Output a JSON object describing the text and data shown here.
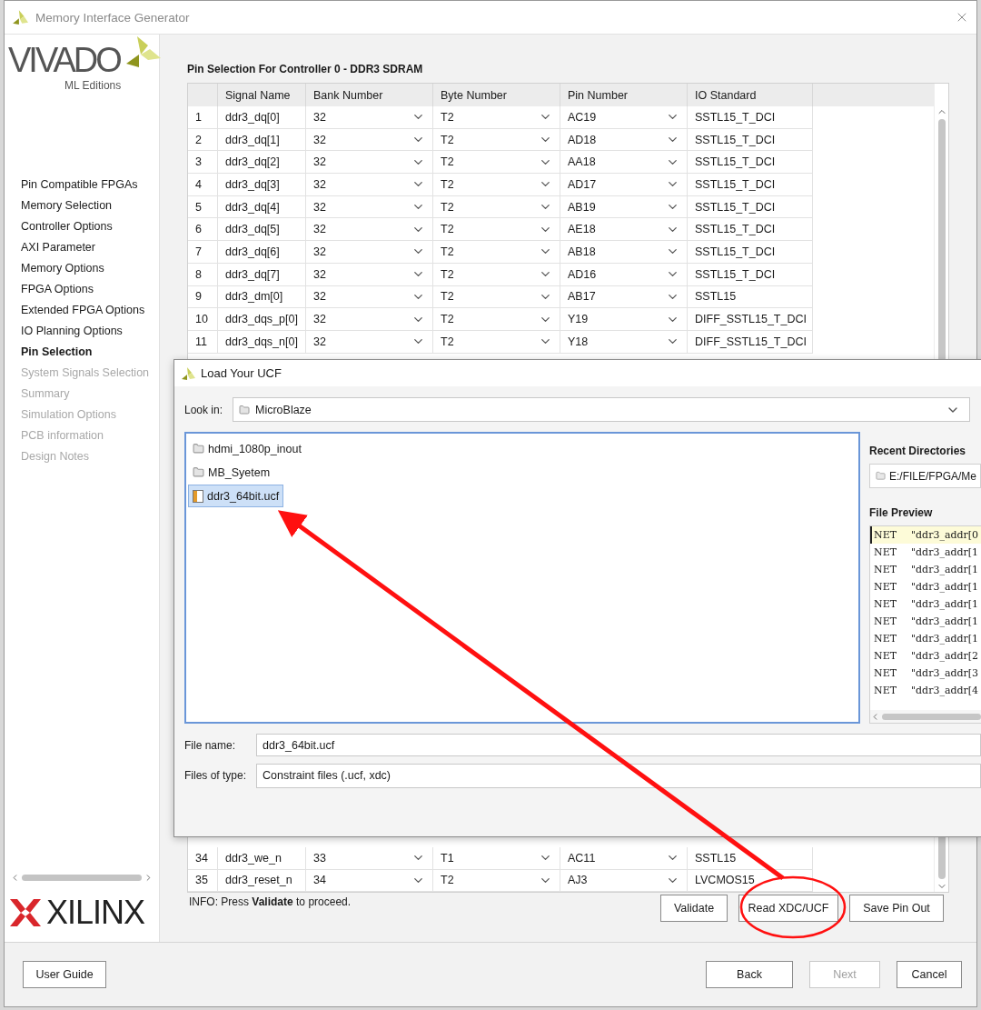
{
  "window": {
    "title": "Memory Interface Generator"
  },
  "logo": {
    "product": "VIVADO",
    "edition": "ML Editions",
    "vendor": "XILINX"
  },
  "sidebar": {
    "items": [
      {
        "label": "Pin Compatible FPGAs",
        "selected": false,
        "disabled": false
      },
      {
        "label": "Memory Selection",
        "selected": false,
        "disabled": false
      },
      {
        "label": "Controller Options",
        "selected": false,
        "disabled": false
      },
      {
        "label": "AXI Parameter",
        "selected": false,
        "disabled": false
      },
      {
        "label": "Memory Options",
        "selected": false,
        "disabled": false
      },
      {
        "label": "FPGA Options",
        "selected": false,
        "disabled": false
      },
      {
        "label": "Extended FPGA Options",
        "selected": false,
        "disabled": false
      },
      {
        "label": "IO Planning Options",
        "selected": false,
        "disabled": false
      },
      {
        "label": "Pin Selection",
        "selected": true,
        "disabled": false
      },
      {
        "label": "System Signals Selection",
        "selected": false,
        "disabled": true
      },
      {
        "label": "Summary",
        "selected": false,
        "disabled": true
      },
      {
        "label": "Simulation Options",
        "selected": false,
        "disabled": true
      },
      {
        "label": "PCB information",
        "selected": false,
        "disabled": true
      },
      {
        "label": "Design Notes",
        "selected": false,
        "disabled": true
      }
    ]
  },
  "page": {
    "heading": "Pin Selection For Controller 0 - DDR3 SDRAM",
    "table": {
      "columns": [
        "Signal Name",
        "Bank Number",
        "Byte Number",
        "Pin Number",
        "IO Standard"
      ],
      "rows": [
        {
          "index": "1",
          "signal": "ddr3_dq[0]",
          "bank": "32",
          "byte": "T2",
          "pin": "AC19",
          "io_standard": "SSTL15_T_DCI"
        },
        {
          "index": "2",
          "signal": "ddr3_dq[1]",
          "bank": "32",
          "byte": "T2",
          "pin": "AD18",
          "io_standard": "SSTL15_T_DCI"
        },
        {
          "index": "3",
          "signal": "ddr3_dq[2]",
          "bank": "32",
          "byte": "T2",
          "pin": "AA18",
          "io_standard": "SSTL15_T_DCI"
        },
        {
          "index": "4",
          "signal": "ddr3_dq[3]",
          "bank": "32",
          "byte": "T2",
          "pin": "AD17",
          "io_standard": "SSTL15_T_DCI"
        },
        {
          "index": "5",
          "signal": "ddr3_dq[4]",
          "bank": "32",
          "byte": "T2",
          "pin": "AB19",
          "io_standard": "SSTL15_T_DCI"
        },
        {
          "index": "6",
          "signal": "ddr3_dq[5]",
          "bank": "32",
          "byte": "T2",
          "pin": "AE18",
          "io_standard": "SSTL15_T_DCI"
        },
        {
          "index": "7",
          "signal": "ddr3_dq[6]",
          "bank": "32",
          "byte": "T2",
          "pin": "AB18",
          "io_standard": "SSTL15_T_DCI"
        },
        {
          "index": "8",
          "signal": "ddr3_dq[7]",
          "bank": "32",
          "byte": "T2",
          "pin": "AD16",
          "io_standard": "SSTL15_T_DCI"
        },
        {
          "index": "9",
          "signal": "ddr3_dm[0]",
          "bank": "32",
          "byte": "T2",
          "pin": "AB17",
          "io_standard": "SSTL15"
        },
        {
          "index": "10",
          "signal": "ddr3_dqs_p[0]",
          "bank": "32",
          "byte": "T2",
          "pin": "Y19",
          "io_standard": "DIFF_SSTL15_T_DCI"
        },
        {
          "index": "11",
          "signal": "ddr3_dqs_n[0]",
          "bank": "32",
          "byte": "T2",
          "pin": "Y18",
          "io_standard": "DIFF_SSTL15_T_DCI"
        }
      ],
      "bottom_rows": [
        {
          "index": "34",
          "signal": "ddr3_we_n",
          "bank": "33",
          "byte": "T1",
          "pin": "AC11",
          "io_standard": "SSTL15"
        },
        {
          "index": "35",
          "signal": "ddr3_reset_n",
          "bank": "34",
          "byte": "T2",
          "pin": "AJ3",
          "io_standard": "LVCMOS15"
        }
      ]
    },
    "info": "INFO: Press **Validate** to proceed.",
    "actions": [
      {
        "label": "Validate"
      },
      {
        "label": "Read XDC/UCF"
      },
      {
        "label": "Save Pin Out"
      }
    ]
  },
  "footer": {
    "help": "User Guide",
    "nav": [
      {
        "label": "Back",
        "disabled": false
      },
      {
        "label": "Next",
        "disabled": true
      },
      {
        "label": "Cancel",
        "disabled": false
      }
    ]
  },
  "dialog": {
    "title": "Load Your UCF",
    "look_in": {
      "label": "Look in:",
      "value": "MicroBlaze"
    },
    "files": [
      {
        "name": "hdmi_1080p_inout",
        "kind": "folder",
        "selected": false
      },
      {
        "name": "MB_Syetem",
        "kind": "folder",
        "selected": false
      },
      {
        "name": "ddr3_64bit.ucf",
        "kind": "file",
        "selected": true
      }
    ],
    "recent": {
      "label": "Recent Directories",
      "value": "E:/FILE/FPGA/Me"
    },
    "preview": {
      "label": "File Preview",
      "lines": [
        {
          "keyword": "NET",
          "text": "\"ddr3_addr[0",
          "selected": true
        },
        {
          "keyword": "NET",
          "text": "\"ddr3_addr[1",
          "selected": false
        },
        {
          "keyword": "NET",
          "text": "\"ddr3_addr[1",
          "selected": false
        },
        {
          "keyword": "NET",
          "text": "\"ddr3_addr[1",
          "selected": false
        },
        {
          "keyword": "NET",
          "text": "\"ddr3_addr[1",
          "selected": false
        },
        {
          "keyword": "NET",
          "text": "\"ddr3_addr[1",
          "selected": false
        },
        {
          "keyword": "NET",
          "text": "\"ddr3_addr[1",
          "selected": false
        },
        {
          "keyword": "NET",
          "text": "\"ddr3_addr[2",
          "selected": false
        },
        {
          "keyword": "NET",
          "text": "\"ddr3_addr[3",
          "selected": false
        },
        {
          "keyword": "NET",
          "text": "\"ddr3_addr[4",
          "selected": false
        }
      ]
    },
    "file_name": {
      "label": "File name:",
      "value": "ddr3_64bit.ucf"
    },
    "file_type": {
      "label": "Files of type:",
      "value": "Constraint files (.ucf, xdc)"
    }
  }
}
